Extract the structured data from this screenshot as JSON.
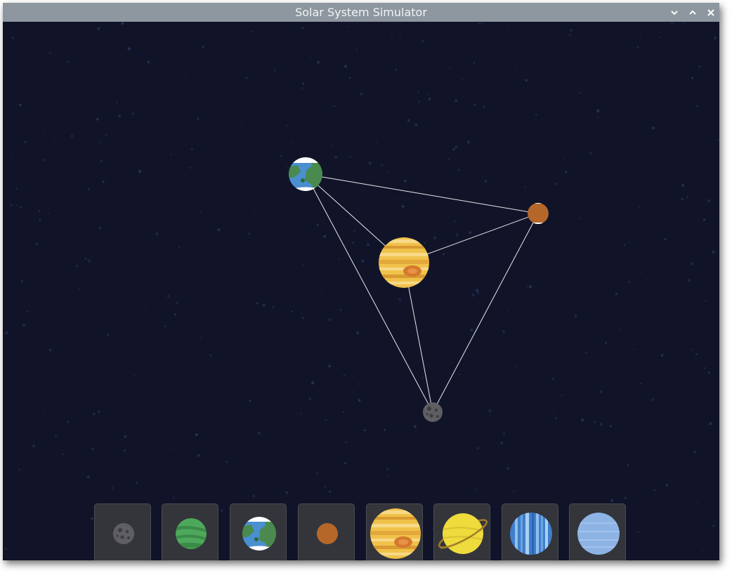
{
  "window": {
    "title": "Solar System Simulator",
    "controls": [
      "minimize",
      "maximize",
      "close"
    ]
  },
  "scene": {
    "background_color": "#111428",
    "bodies": [
      "Earth",
      "Mars",
      "Jupiter",
      "Moon"
    ],
    "connections": [
      [
        "Earth",
        "Mars"
      ],
      [
        "Earth",
        "Jupiter"
      ],
      [
        "Earth",
        "Moon"
      ],
      [
        "Mars",
        "Jupiter"
      ],
      [
        "Mars",
        "Moon"
      ],
      [
        "Jupiter",
        "Moon"
      ]
    ]
  },
  "palette": {
    "items": [
      "Moon",
      "Venus",
      "Earth",
      "Mars",
      "Jupiter",
      "Saturn",
      "Uranus",
      "Neptune"
    ]
  }
}
